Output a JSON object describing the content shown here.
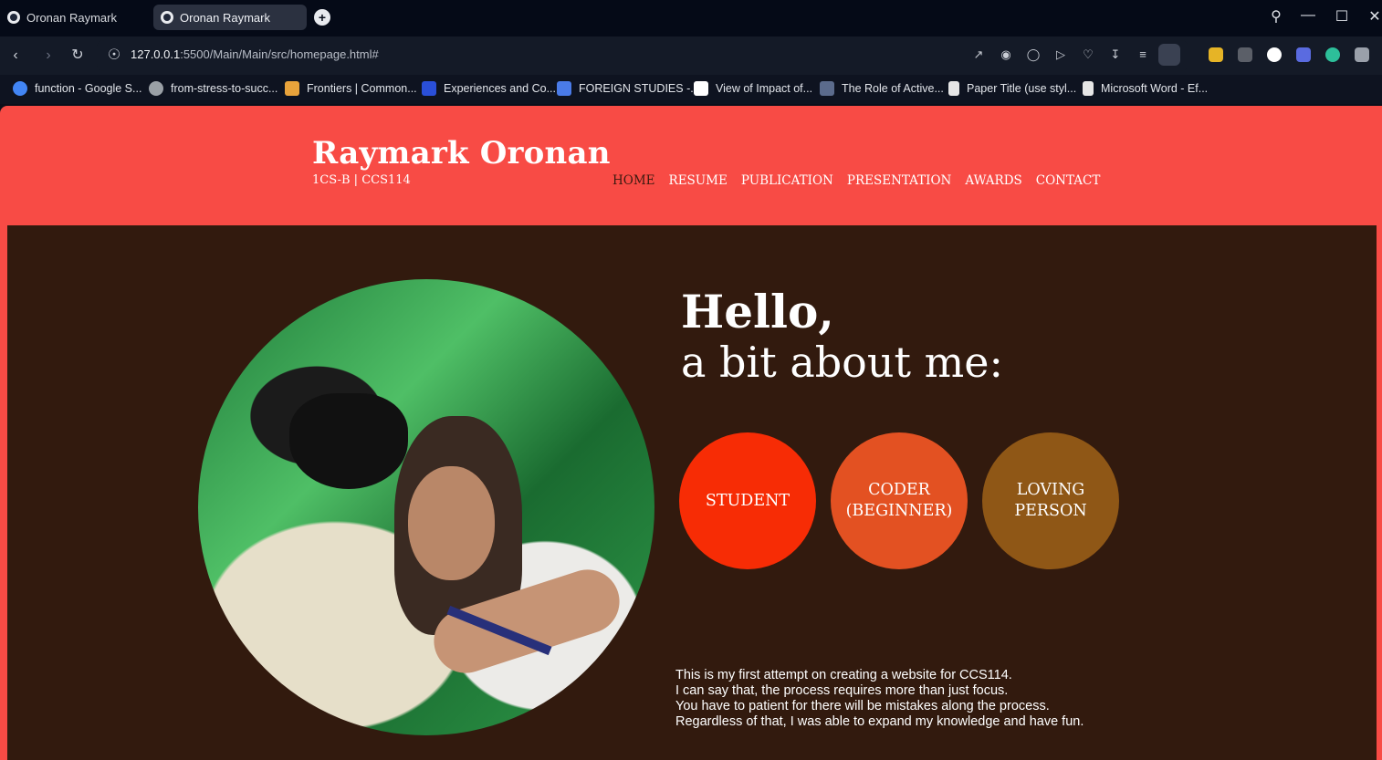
{
  "browser": {
    "tabs": [
      {
        "label": "Oronan Raymark",
        "active": false
      },
      {
        "label": "Oronan Raymark",
        "active": true
      }
    ],
    "url": {
      "host": "127.0.0.1",
      "rest": ":5500/Main/Main/src/homepage.html#"
    },
    "bookmarks": [
      {
        "label": "function - Google S...",
        "icon_color": "#4285f4"
      },
      {
        "label": "from-stress-to-succ...",
        "icon_color": "#9aa0a6"
      },
      {
        "label": "Frontiers | Common...",
        "icon_color": "#e8a33b"
      },
      {
        "label": "Experiences and Co...",
        "icon_color": "#2a4fd8"
      },
      {
        "label": "FOREIGN STUDIES -...",
        "icon_color": "#4a7be8"
      },
      {
        "label": "View of Impact of...",
        "icon_color": "#ffffff"
      },
      {
        "label": "The Role of Active...",
        "icon_color": "#5b6b8c"
      },
      {
        "label": "Paper Title (use styl...",
        "icon_color": "#e6e6e6"
      },
      {
        "label": "Microsoft Word - Ef...",
        "icon_color": "#e6e6e6"
      }
    ]
  },
  "site": {
    "title": "Raymark Oronan",
    "subtitle": "1CS-B | CCS114",
    "nav": [
      {
        "label": "HOME",
        "active": true
      },
      {
        "label": "RESUME",
        "active": false
      },
      {
        "label": "PUBLICATION",
        "active": false
      },
      {
        "label": "PRESENTATION",
        "active": false
      },
      {
        "label": "AWARDS",
        "active": false
      },
      {
        "label": "CONTACT",
        "active": false
      }
    ],
    "hero": {
      "greeting": "Hello,",
      "heading": "a bit about me:"
    },
    "traits": [
      {
        "label": "STUDENT",
        "color": "#f72c05"
      },
      {
        "label": "CODER (BEGINNER)",
        "color": "#e35122"
      },
      {
        "label": "LOVING PERSON",
        "color": "#8f5716"
      }
    ],
    "about_lines": [
      "This is my first attempt on creating a website for CCS114.",
      "I can say that, the process requires more than just focus.",
      "You have to patient for there will be mistakes along the process.",
      "Regardless of that, I was able to expand my knowledge and have fun."
    ],
    "colors": {
      "header_bg": "#f84b45",
      "content_bg": "#321a0e",
      "nav_active": "#3b1a10"
    }
  }
}
